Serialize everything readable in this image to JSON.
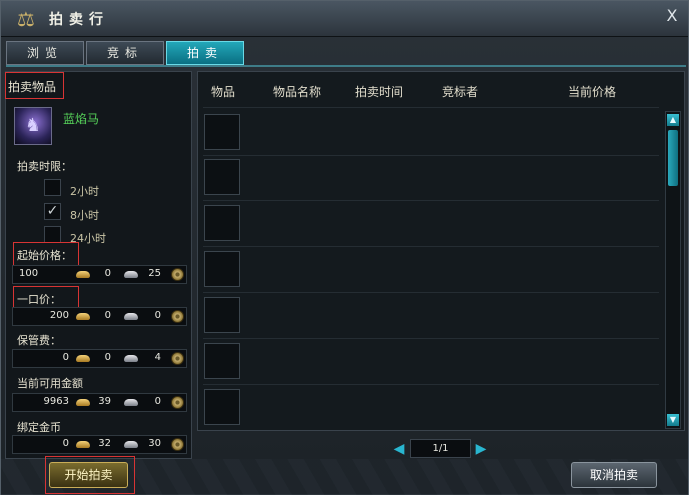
{
  "window": {
    "title": "拍卖行",
    "close_glyph": "X"
  },
  "tabs": [
    {
      "label": "浏览",
      "active": false
    },
    {
      "label": "竞标",
      "active": false
    },
    {
      "label": "拍卖",
      "active": true
    }
  ],
  "left": {
    "section_label": "拍卖物品",
    "item": {
      "name": "蓝焰马",
      "icon": "blue-flame-horse-icon"
    },
    "duration": {
      "label": "拍卖时限：",
      "options": [
        {
          "label": "2小时",
          "checked": false
        },
        {
          "label": "8小时",
          "checked": true
        },
        {
          "label": "24小时",
          "checked": false
        }
      ]
    },
    "start_price": {
      "label": "起始价格：",
      "gold": "100",
      "silver": "0",
      "bronze_silver": "25"
    },
    "buyout": {
      "label": "一口价：",
      "gold": "200",
      "silver": "0",
      "bronze_silver": "0"
    },
    "deposit": {
      "label": "保管费：",
      "gold": "0",
      "silver": "0",
      "bronze_silver": "4"
    },
    "available": {
      "label": "当前可用金额",
      "gold": "9963",
      "silver": "39",
      "bronze_silver": "0"
    },
    "bound": {
      "label": "绑定金币",
      "gold": "0",
      "silver": "32",
      "bronze_silver": "30"
    }
  },
  "table": {
    "headers": [
      "物品",
      "物品名称",
      "拍卖时间",
      "竞标者",
      "当前价格"
    ],
    "rows": 7
  },
  "pager": {
    "text": "1/1"
  },
  "buttons": {
    "start": "开始拍卖",
    "cancel": "取消拍卖"
  },
  "colors": {
    "accent": "#23a7b9",
    "highlight": "#d83434",
    "item_name": "#56d35a"
  }
}
